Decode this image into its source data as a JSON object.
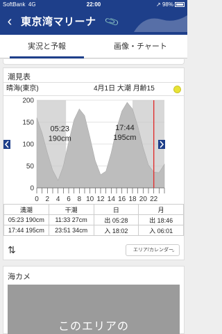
{
  "status_bar": {
    "carrier": "SoftBank",
    "network": "4G",
    "time": "22:00",
    "battery": "98%"
  },
  "nav": {
    "back_icon": "chevron-left-icon",
    "title": "東京湾マリーナ",
    "clip_icon": "paperclip-icon"
  },
  "tabs": [
    {
      "label": "実況と予報",
      "active": true
    },
    {
      "label": "画像・チャート",
      "active": false
    }
  ],
  "tide": {
    "section_title": "潮見表",
    "location": "晴海(東京)",
    "date": "4月1日",
    "tide_type": "大潮",
    "moon_age": "月齢15",
    "chart_data": {
      "type": "area",
      "x_ticks": [
        "0",
        "2",
        "4",
        "6",
        "8",
        "10",
        "12",
        "14",
        "16",
        "18",
        "20",
        "22"
      ],
      "y_ticks": [
        "0",
        "50",
        "100",
        "150",
        "200"
      ],
      "ylim": [
        0,
        200
      ],
      "xlim": [
        0,
        24
      ],
      "points": [
        [
          0,
          160
        ],
        [
          1,
          125
        ],
        [
          2,
          80
        ],
        [
          3,
          40
        ],
        [
          4,
          17
        ],
        [
          5,
          50
        ],
        [
          6,
          105
        ],
        [
          7,
          155
        ],
        [
          8,
          180
        ],
        [
          9,
          165
        ],
        [
          10,
          115
        ],
        [
          11,
          62
        ],
        [
          12,
          30
        ],
        [
          13,
          38
        ],
        [
          14,
          80
        ],
        [
          15,
          135
        ],
        [
          16,
          175
        ],
        [
          17,
          195
        ],
        [
          18,
          180
        ],
        [
          19,
          140
        ],
        [
          20,
          92
        ],
        [
          21,
          52
        ],
        [
          22,
          36
        ],
        [
          23,
          35
        ],
        [
          24,
          54
        ]
      ],
      "night_before": 5.5,
      "night_after": 18.0,
      "current_hour": 22.0,
      "annotations": [
        {
          "time": "05:23",
          "height": "190cm",
          "hour": 5.38,
          "level": 190
        },
        {
          "time": "11:33",
          "height": "27cm",
          "hour": 11.55,
          "level": 27
        },
        {
          "time": "17:44",
          "height": "195cm",
          "hour": 17.73,
          "level": 195
        },
        {
          "time": "23:51",
          "height": "34cm",
          "hour": 23.85,
          "level": 34
        }
      ]
    },
    "table": {
      "headers": [
        "満潮",
        "干潮",
        "日",
        "月"
      ],
      "rows": [
        [
          "05:23 190cm",
          "11:33 27cm",
          "出 05:28",
          "出 18:46"
        ],
        [
          "17:44 195cm",
          "23:51 34cm",
          "入 18:02",
          "入 06:01"
        ]
      ]
    },
    "swap_icon": "swap-vertical-icon",
    "dropdown_label": "エリア/カレンダー"
  },
  "camera": {
    "section_title": "海カメ",
    "overlay_text": "このエリアの"
  },
  "colors": {
    "nav": "#1e3f8a",
    "night": "#d8d8d8",
    "tide_fill": "#bdbdbd",
    "current_line": "#e03030",
    "moon": "#e8e336"
  }
}
